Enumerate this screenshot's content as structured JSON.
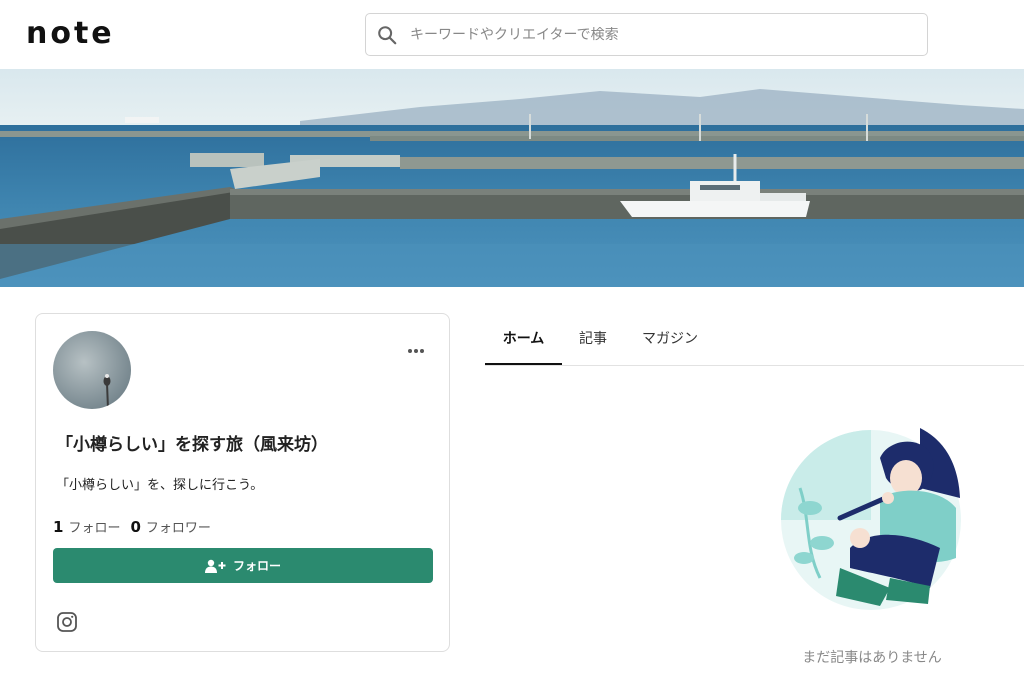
{
  "header": {
    "logo": "note",
    "search": {
      "placeholder": "キーワードやクリエイターで検索"
    }
  },
  "profile": {
    "name": "「小樽らしい」を探す旅（風来坊）",
    "bio": "「小樽らしい」を、探しに行こう。",
    "following_count": "1",
    "following_label": "フォロー",
    "followers_count": "0",
    "followers_label": "フォロワー",
    "follow_button_label": "フォロー"
  },
  "tabs": [
    {
      "label": "ホーム",
      "active": true
    },
    {
      "label": "記事",
      "active": false
    },
    {
      "label": "マガジン",
      "active": false
    }
  ],
  "empty_state": {
    "message": "まだ記事はありません"
  },
  "colors": {
    "accent": "#2b8a6f",
    "illustration_teal": "#8ed6d0",
    "illustration_navy": "#1d2c6b"
  },
  "icons": {
    "search": "search-icon",
    "more": "more-dots-icon",
    "follow": "user-plus-icon",
    "instagram": "instagram-icon"
  }
}
